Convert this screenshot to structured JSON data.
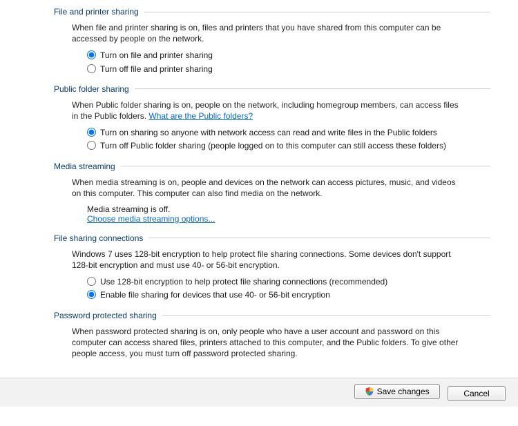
{
  "sections": {
    "filePrinter": {
      "title": "File and printer sharing",
      "desc": "When file and printer sharing is on, files and printers that you have shared from this computer can be accessed by people on the network.",
      "optOn": "Turn on file and printer sharing",
      "optOff": "Turn off file and printer sharing"
    },
    "publicFolder": {
      "title": "Public folder sharing",
      "desc1": "When Public folder sharing is on, people on the network, including homegroup members, can access files in the Public folders. ",
      "linkText": "What are the Public folders?",
      "optOn": "Turn on sharing so anyone with network access can read and write files in the Public folders",
      "optOff": "Turn off Public folder sharing (people logged on to this computer can still access these folders)"
    },
    "mediaStreaming": {
      "title": "Media streaming",
      "desc": "When media streaming is on, people and devices on the network can access pictures, music, and videos on this computer. This computer can also find media on the network.",
      "status": "Media streaming is off.",
      "chooseLink": "Choose media streaming options..."
    },
    "fileSharingConnections": {
      "title": "File sharing connections",
      "desc": "Windows 7 uses 128-bit encryption to help protect file sharing connections. Some devices don't support 128-bit encryption and must use 40- or 56-bit encryption.",
      "opt128": "Use 128-bit encryption to help protect file sharing connections (recommended)",
      "opt40": "Enable file sharing for devices that use 40- or 56-bit encryption"
    },
    "passwordProtected": {
      "title": "Password protected sharing",
      "desc": "When password protected sharing is on, only people who have a user account and password on this computer can access shared files, printers attached to this computer, and the Public folders. To give other people access, you must turn off password protected sharing."
    }
  },
  "footer": {
    "save": "Save changes",
    "cancel": "Cancel"
  }
}
